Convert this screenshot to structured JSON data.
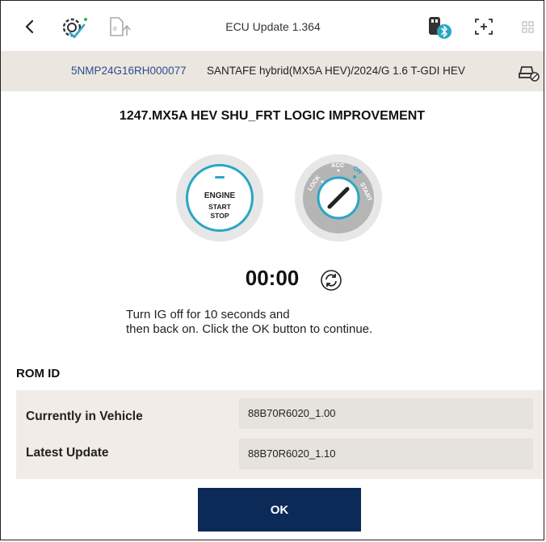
{
  "header": {
    "title": "ECU Update 1.364",
    "icons": [
      "back-icon",
      "diagnosis-gear-icon",
      "document-upload-icon",
      "bluetooth-device-icon",
      "capture-icon",
      "grid-menu-icon"
    ]
  },
  "vehicle": {
    "vin": "5NMP24G16RH000077",
    "description": "SANTAFE hybrid(MX5A HEV)/2024/G 1.6 T-GDI HEV"
  },
  "step": {
    "title": "1247.MX5A HEV SHU_FRT LOGIC IMPROVEMENT"
  },
  "engine_button": {
    "line1": "ENGINE",
    "line2": "START",
    "line3": "STOP"
  },
  "ignition": {
    "lock": "LOCK",
    "acc": "ACC",
    "on": "ON",
    "start": "START"
  },
  "timer": {
    "value": "00:00"
  },
  "instruction": {
    "line1": "Turn IG off for 10 seconds and",
    "line2": "then back on. Click the OK button to continue."
  },
  "rom": {
    "title": "ROM ID",
    "rows": [
      {
        "label": "Currently in Vehicle",
        "value": "88B70R6020_1.00"
      },
      {
        "label": "Latest Update",
        "value": "88B70R6020_1.10"
      }
    ]
  },
  "ok_button": {
    "label": "OK"
  },
  "colors": {
    "accent": "#2aa6c4",
    "primary_button": "#0c2a57",
    "vehicle_bar": "#ece6e0",
    "vin_text": "#2a4e8c"
  }
}
